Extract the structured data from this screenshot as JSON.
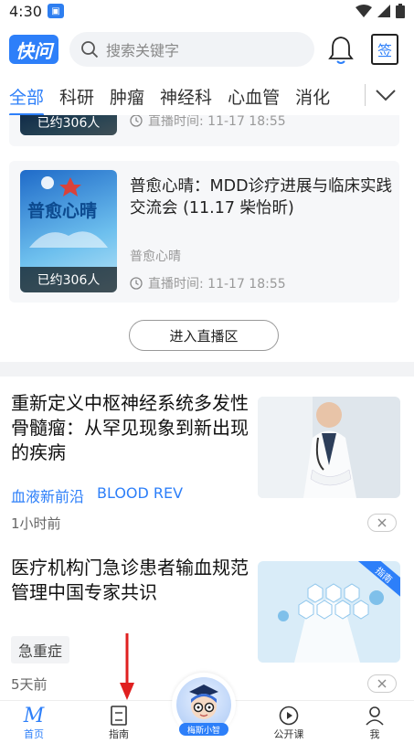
{
  "status_bar": {
    "time": "4:30"
  },
  "header": {
    "logo": "快问",
    "search_placeholder": "搜索关键字",
    "sign_label": "签"
  },
  "tabs": [
    "全部",
    "科研",
    "肿瘤",
    "神经科",
    "心血管",
    "消化"
  ],
  "live_cards": [
    {
      "viewers": "已约306人",
      "time": "直播时间: 11-17 18:55"
    },
    {
      "title": "普愈心晴：MDD诊疗进展与临床实践交流会 (11.17 柴怡昕)",
      "host": "普愈心晴",
      "thumb_text": "普愈心晴",
      "viewers": "已约306人",
      "time": "直播时间: 11-17 18:55"
    }
  ],
  "enter_live_label": "进入直播区",
  "articles": [
    {
      "title": "重新定义中枢神经系统多发性骨髓瘤：从罕见现象到新出现的疾病",
      "tags": [
        "血液新前沿",
        "BLOOD REV"
      ],
      "time": "1小时前"
    },
    {
      "title": "医疗机构门急诊患者输血规范管理中国专家共识",
      "chip": "急重症",
      "corner": "指南",
      "time": "5天前"
    }
  ],
  "bottom_nav": {
    "home": "首页",
    "guide": "指南",
    "center": "梅斯小智",
    "course": "公开课",
    "me": "我"
  },
  "colors": {
    "accent": "#2d7ff9",
    "annotation_arrow": "#e02020"
  }
}
